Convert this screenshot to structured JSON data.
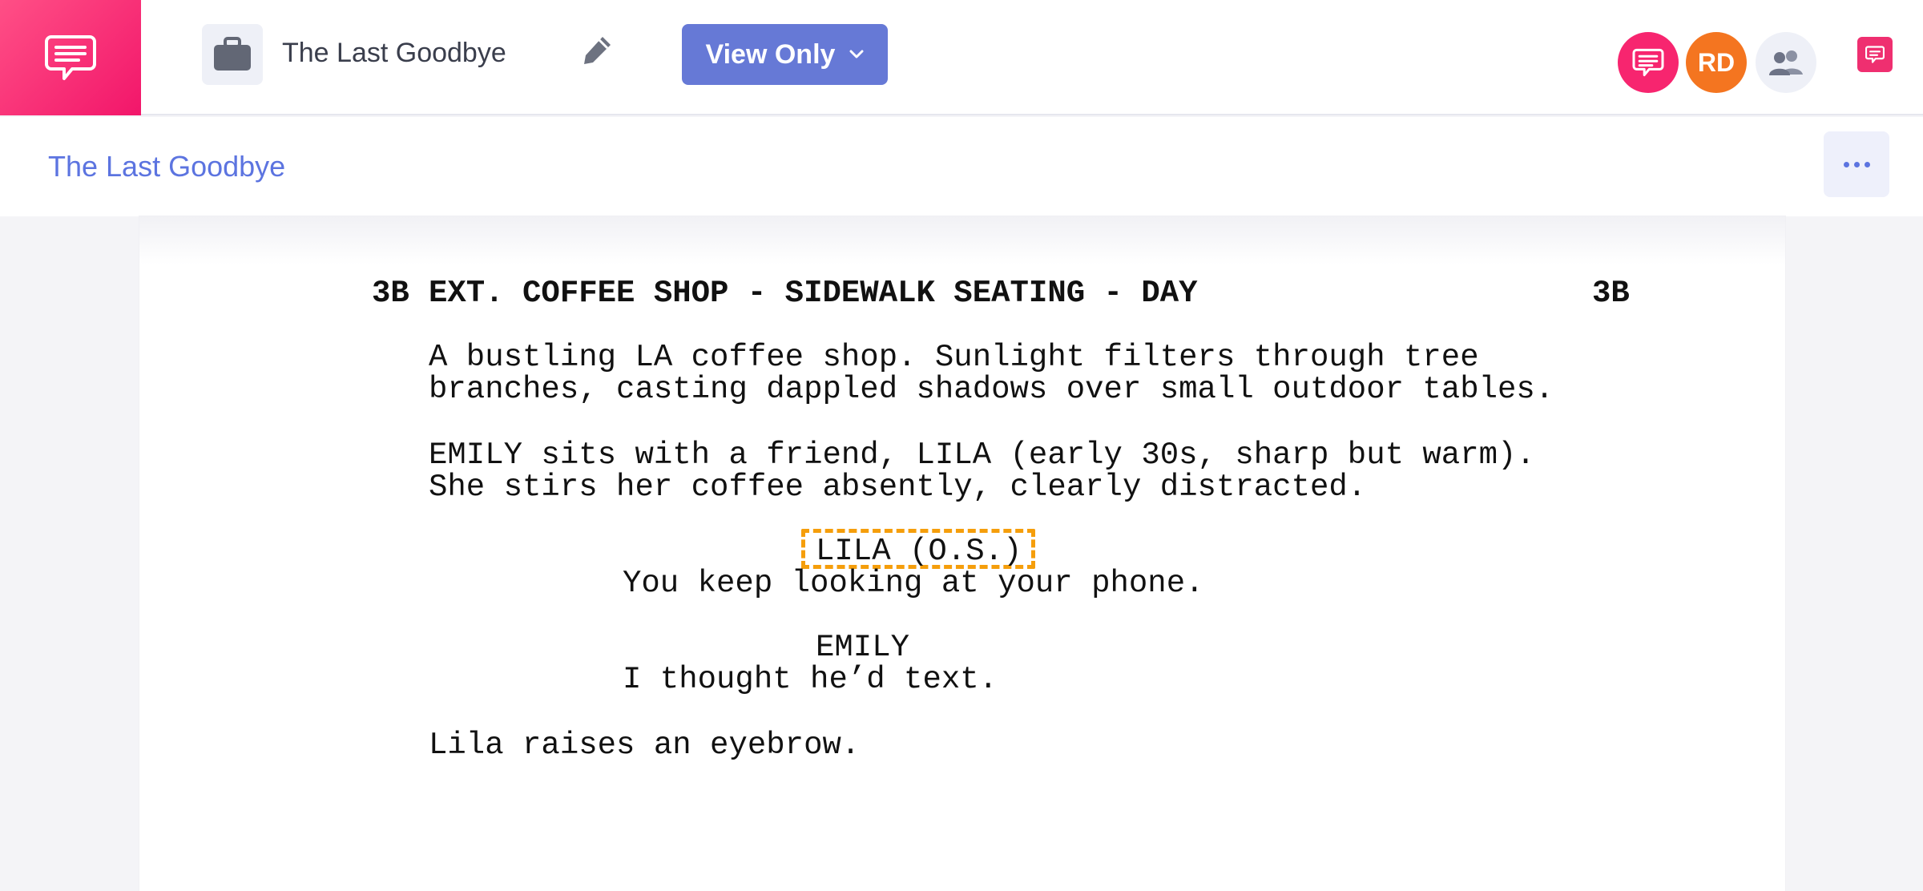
{
  "header": {
    "project_title": "The Last Goodbye",
    "view_mode_label": "View Only",
    "user_initials": "RD",
    "brand_color": "#f7256f",
    "accent_color": "#6679d6"
  },
  "subheader": {
    "document_title": "The Last Goodbye"
  },
  "script": {
    "scene_number_left": "3B",
    "scene_heading": "EXT. COFFEE SHOP - SIDEWALK SEATING - DAY",
    "scene_number_right": "3B",
    "action_1_line_1": "A bustling LA coffee shop. Sunlight filters through tree",
    "action_1_line_2": "branches, casting dappled shadows over small outdoor tables.",
    "action_2_line_1": "EMILY sits with a friend, LILA (early 30s, sharp but warm).",
    "action_2_line_2": "She stirs her coffee absently, clearly distracted.",
    "character_1": "LILA (O.S.)",
    "dialogue_1": "You keep looking at your phone.",
    "character_2": "EMILY",
    "dialogue_2": "I thought he’d text.",
    "action_3": "Lila raises an eyebrow."
  },
  "icons": {
    "brand": "chat-bubble-icon",
    "project": "briefcase-icon",
    "edit": "pencil-icon",
    "dropdown": "chevron-down-icon",
    "team": "users-icon",
    "more": "ellipsis-icon"
  }
}
